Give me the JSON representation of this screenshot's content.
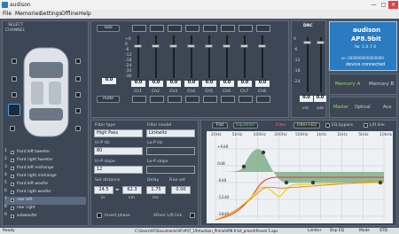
{
  "window": {
    "title": "audison",
    "minimize": "—",
    "maximize": "□",
    "close": "✕"
  },
  "menu": [
    "File",
    "Memories",
    "Settings",
    "Offline",
    "Help"
  ],
  "left_panel": {
    "title_line1": "SELECT",
    "title_line2": "CHANNEL"
  },
  "channels": [
    {
      "num": "1",
      "name": "front left tweeter"
    },
    {
      "num": "2",
      "name": "front right tweeter"
    },
    {
      "num": "3",
      "name": "front left midrange"
    },
    {
      "num": "4",
      "name": "front right midrange"
    },
    {
      "num": "5",
      "name": "front left woofer"
    },
    {
      "num": "6",
      "name": "front right woofer"
    },
    {
      "num": "7",
      "name": "rear left"
    },
    {
      "num": "8",
      "name": "rear right"
    },
    {
      "num": "9",
      "name": "subwoofer"
    }
  ],
  "mixer": {
    "solo_label": "solo",
    "mute_label": "mute",
    "ref_label": "0.0",
    "db_scale": [
      "+6",
      "0",
      "-6",
      "-12",
      "-18",
      "-24",
      "-30",
      "-36",
      "-42",
      "-48"
    ],
    "channels": [
      {
        "label": "Ch1",
        "value": "0.0",
        "level": 0.78
      },
      {
        "label": "Ch2",
        "value": "0.0",
        "level": 0.78
      },
      {
        "label": "Ch3",
        "value": "0.0",
        "level": 0.78
      },
      {
        "label": "Ch4",
        "value": "0.0",
        "level": 0.78
      },
      {
        "label": "Ch5",
        "value": "0.0",
        "level": 0.78
      },
      {
        "label": "Ch6",
        "value": "0.0",
        "level": 0.78
      },
      {
        "label": "Ch7",
        "value": "0.0",
        "level": 0.78
      },
      {
        "label": "Ch8",
        "value": "0.0",
        "level": 0.78
      }
    ]
  },
  "drc": {
    "title": "DRC",
    "vol_label": "vol",
    "sub_label": "sub",
    "vol_value": "0.0",
    "sub_value": "0.0",
    "scale": [
      "0",
      "-6",
      "-12",
      "-18",
      "-24",
      "-30",
      "-36"
    ]
  },
  "device": {
    "brand": "audison",
    "model": "AP8.9bit",
    "fw": "fw: 1.0.7.0",
    "sn": "sn: 0000000000000000",
    "status": "device connected"
  },
  "memory": {
    "a": "Memory A",
    "b": "Memory B"
  },
  "source": {
    "master": "Master",
    "optical": "Optical",
    "aux": "Aux"
  },
  "filter": {
    "type_label": "Filter type",
    "type_value": "High Pass",
    "model_label": "Filter model",
    "model_value": "Linkwitz",
    "hip_hz_label": "Hi-P Hz",
    "hip_hz_value": "80",
    "lop_hz_label": "Lo-P Hz",
    "lop_hz_value": "",
    "hip_slope_label": "Hi-P slope",
    "hip_slope_value": "12",
    "lop_slope_label": "Lo-P slope",
    "lop_slope_value": "",
    "distance_label": "Set distance",
    "distance_in": "24.5",
    "distance_cm": "62.3",
    "distance_in_unit": "in",
    "distance_cm_unit": "cm",
    "delay_label": "Delay",
    "delay_value": "1.75",
    "delay_unit": "ms",
    "finetune_label": "Fine set",
    "finetune_value": "0.00",
    "invert_label": "Invert phase",
    "xover_label": "XOver L/R link"
  },
  "graph": {
    "flat_btn": "Flat",
    "equalizer_btn": "Equalizer",
    "filter_btn": "Filter",
    "filter_eq_btn": "Filter+EQ",
    "eq_bypass": "EQ bypass",
    "lr_link": "L/R link",
    "freq_ticks": [
      "20Hz",
      "50Hz",
      "100Hz",
      "200Hz",
      "500Hz",
      "1kHz",
      "2kHz",
      "5kHz",
      "10kHz"
    ],
    "db_ticks": [
      "+6dB",
      "0dB",
      "-6dB",
      "-12dB",
      "-18dB"
    ],
    "colors": {
      "filter": "#e4352c",
      "eq": "#2fa84f",
      "combined": "#f1d200",
      "response": "#e8882a"
    }
  },
  "statusbar": {
    "left": "Ready",
    "path": "C:\\Users\\AF\\Documents\\AF\\#07_19\\Audison_Prima\\AP8.9 bit_preset\\Preset 5.aps",
    "limiter": "Limiter",
    "dsp": "Dsp EQ",
    "mode": "Mode",
    "std": "STD"
  }
}
